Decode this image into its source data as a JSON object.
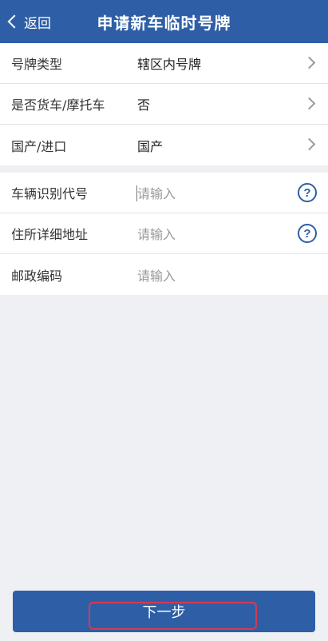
{
  "header": {
    "back_label": "返回",
    "title": "申请新车临时号牌"
  },
  "form": {
    "selects": [
      {
        "label": "号牌类型",
        "value": "辖区内号牌"
      },
      {
        "label": "是否货车/摩托车",
        "value": "否"
      },
      {
        "label": "国产/进口",
        "value": "国产"
      }
    ],
    "inputs": [
      {
        "label": "车辆识别代号",
        "placeholder": "请输入",
        "help_icon": "?"
      },
      {
        "label": "住所详细地址",
        "placeholder": "请输入",
        "help_icon": "?"
      },
      {
        "label": "邮政编码",
        "placeholder": "请输入"
      }
    ]
  },
  "footer": {
    "next_label": "下一步"
  },
  "colors": {
    "brand": "#2e5fa6",
    "highlight": "#d43a52"
  }
}
